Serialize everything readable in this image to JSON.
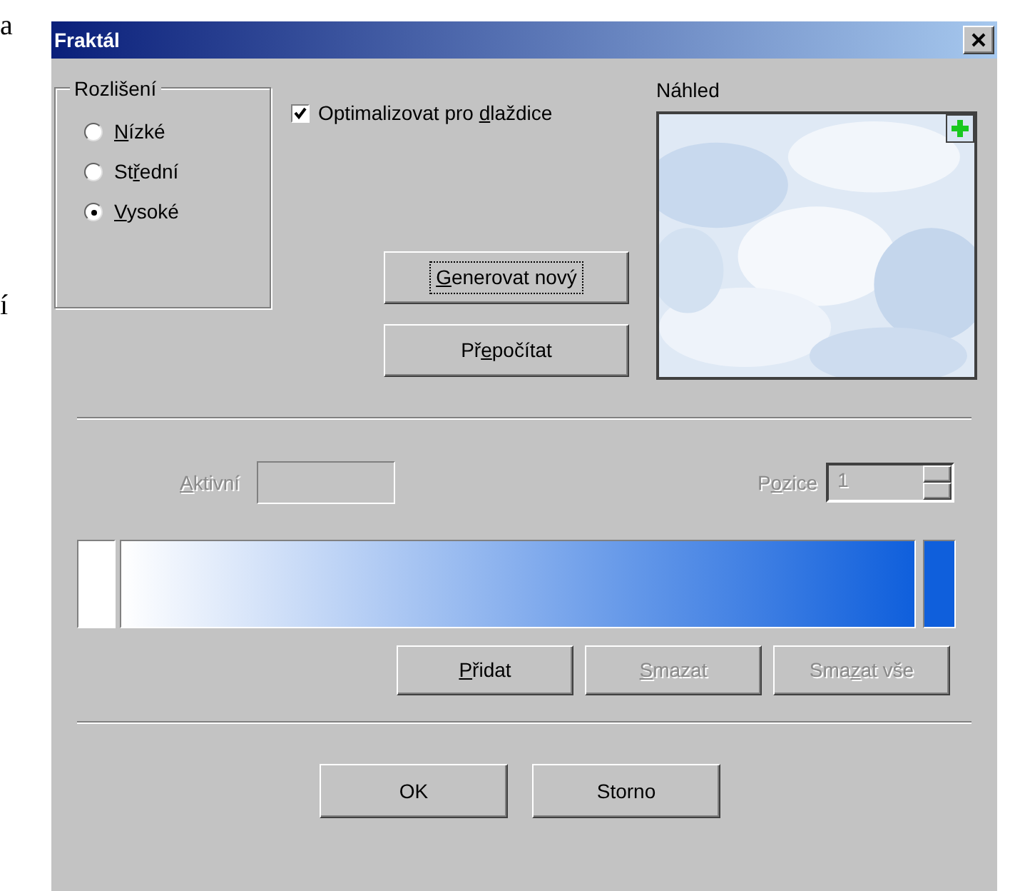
{
  "background_text": [
    "a",
    "í"
  ],
  "window": {
    "title": "Fraktál"
  },
  "resolution": {
    "title": "Rozlišení",
    "options": [
      {
        "label": {
          "key": "N",
          "post": "ízké"
        },
        "selected": false
      },
      {
        "label": {
          "pre": "St",
          "key": "ř",
          "post": "ední"
        },
        "selected": false
      },
      {
        "label": {
          "key": "V",
          "post": "ysoké"
        },
        "selected": true
      }
    ]
  },
  "tile_option": {
    "label": {
      "pre": "Optimalizovat pro ",
      "key": "d",
      "post": "laždice"
    },
    "checked": true
  },
  "preview": {
    "label": "Náhled",
    "kind": "picture"
  },
  "action_buttons": [
    {
      "label": {
        "key": "G",
        "post": "enerovat nový"
      },
      "focused": true
    },
    {
      "label": {
        "pre": "Př",
        "key": "e",
        "post": "počítat"
      },
      "focused": false
    }
  ],
  "active_field": {
    "label": {
      "key": "A",
      "post": "ktivní"
    },
    "disabled": true
  },
  "position_field": {
    "label": {
      "pre": "P",
      "key": "o",
      "post": "zice"
    },
    "value": "1",
    "disabled": true
  },
  "gradient": {
    "stops": [
      {
        "color": "#ffffff"
      },
      {
        "color": "#0f5fdc"
      }
    ]
  },
  "gradient_buttons": [
    {
      "label": {
        "key": "P",
        "post": "řidat"
      },
      "disabled": false
    },
    {
      "label": {
        "key": "S",
        "post": "mazat"
      },
      "disabled": true
    },
    {
      "label": {
        "pre": "Sma",
        "key": "z",
        "post": "at vše"
      },
      "disabled": true
    }
  ],
  "footer_buttons": [
    {
      "label": "OK"
    },
    {
      "label": "Storno"
    }
  ]
}
